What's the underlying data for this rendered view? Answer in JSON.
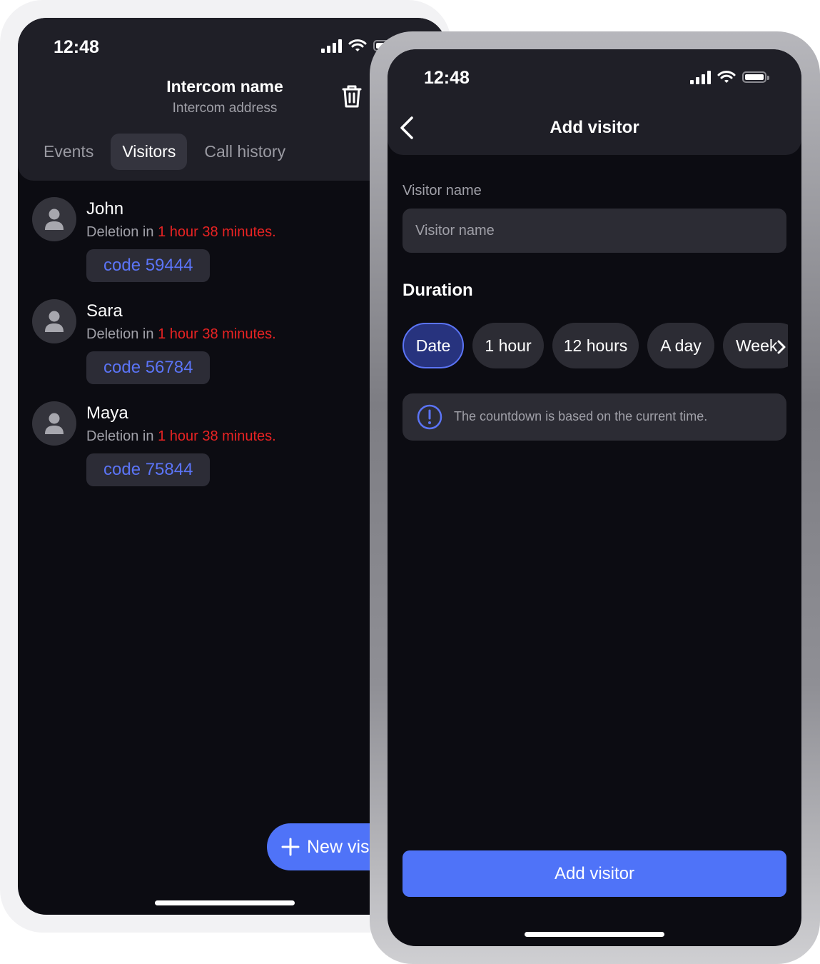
{
  "back_screen": {
    "status_bar": {
      "time": "12:48"
    },
    "header": {
      "title": "Intercom name",
      "subtitle": "Intercom address"
    },
    "tabs": [
      {
        "label": "Events",
        "active": false
      },
      {
        "label": "Visitors",
        "active": true
      },
      {
        "label": "Call history",
        "active": false
      }
    ],
    "visitors": [
      {
        "name": "John",
        "deletion_prefix": "Deletion in ",
        "deletion_time": "1 hour 38 minutes.",
        "code": "code 59444"
      },
      {
        "name": "Sara",
        "deletion_prefix": "Deletion in ",
        "deletion_time": "1 hour 38 minutes.",
        "code": "code 56784"
      },
      {
        "name": "Maya",
        "deletion_prefix": "Deletion in ",
        "deletion_time": "1 hour 38 minutes.",
        "code": "code 75844"
      }
    ],
    "fab_label": "New visi"
  },
  "front_screen": {
    "status_bar": {
      "time": "12:48"
    },
    "header": {
      "title": "Add visitor"
    },
    "visitor_name": {
      "label": "Visitor name",
      "placeholder": "Visitor name",
      "value": ""
    },
    "duration": {
      "title": "Duration",
      "options": [
        {
          "label": "Date",
          "active": true
        },
        {
          "label": "1 hour",
          "active": false
        },
        {
          "label": "12 hours",
          "active": false
        },
        {
          "label": "A day",
          "active": false
        },
        {
          "label": "Week",
          "active": false
        }
      ]
    },
    "info_text": "The countdown is based on the current time.",
    "submit_label": "Add visitor"
  },
  "colors": {
    "accent": "#4f73f8",
    "accent_text": "#5b74f6",
    "warning_red": "#e82323",
    "background": "#0c0c12",
    "surface": "#1f1f27"
  }
}
